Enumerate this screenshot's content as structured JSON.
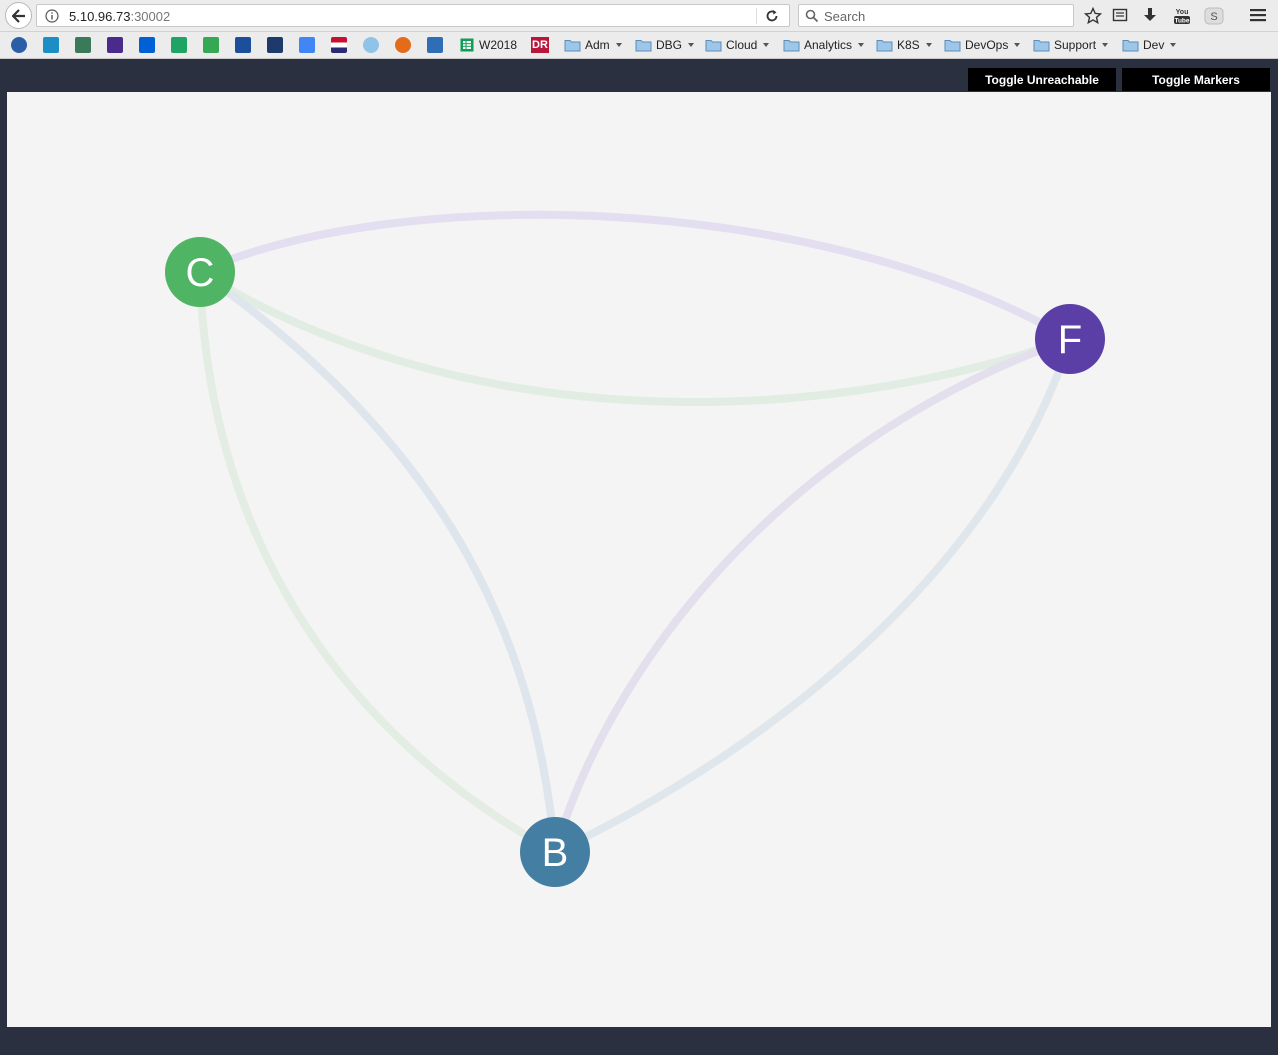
{
  "browser": {
    "url_host": "5.10.96.73",
    "url_port": ":30002",
    "search_placeholder": "Search",
    "bookmarks": [
      {
        "icon": "arrow-circle-icon",
        "color": "#2a5fa8"
      },
      {
        "icon": "network-icon",
        "color": "#1d8ec5"
      },
      {
        "icon": "monitor-icon",
        "color": "#3a7a5a"
      },
      {
        "icon": "mail-icon",
        "color": "#4a2a8a"
      },
      {
        "icon": "box-icon",
        "color": "#0061d5"
      },
      {
        "icon": "drive-icon",
        "color": "#1fa463"
      },
      {
        "icon": "maps-icon",
        "color": "#34a853"
      },
      {
        "icon": "people-icon",
        "color": "#1b4f9c"
      },
      {
        "icon": "script-l-icon",
        "color": "#1d3a6a"
      },
      {
        "icon": "translate-icon",
        "color": "#4285f4"
      },
      {
        "icon": "flag-icon",
        "color": "#c8102e"
      },
      {
        "icon": "cloud-icon",
        "color": "#8fc4e8"
      },
      {
        "icon": "orb-icon",
        "color": "#e36b1a"
      },
      {
        "icon": "tiles-icon",
        "color": "#2f6db5"
      }
    ],
    "sheet_bookmark": "W2018",
    "red_bookmark_text": "DR",
    "folders": [
      "Adm",
      "DBG",
      "Cloud",
      "Analytics",
      "K8S",
      "DevOps",
      "Support",
      "Dev"
    ]
  },
  "app": {
    "toggle_unreachable": "Toggle Unreachable",
    "toggle_markers": "Toggle Markers"
  },
  "graph": {
    "nodes": [
      {
        "id": "C",
        "label": "C",
        "color": "#4fb463"
      },
      {
        "id": "F",
        "label": "F",
        "color": "#5b3ea6"
      },
      {
        "id": "B",
        "label": "B",
        "color": "#457ea3"
      }
    ],
    "edges": [
      {
        "from": "C",
        "to": "F",
        "curve": "upper",
        "color": "#e3def0"
      },
      {
        "from": "C",
        "to": "F",
        "curve": "lower",
        "color": "#e1ece2"
      },
      {
        "from": "C",
        "to": "B",
        "curve": "outer",
        "color": "#e3ede3"
      },
      {
        "from": "C",
        "to": "B",
        "curve": "inner",
        "color": "#dee5ec"
      },
      {
        "from": "F",
        "to": "B",
        "curve": "inner",
        "color": "#e3dfec"
      },
      {
        "from": "F",
        "to": "B",
        "curve": "outer",
        "color": "#e0e7ec"
      }
    ]
  }
}
